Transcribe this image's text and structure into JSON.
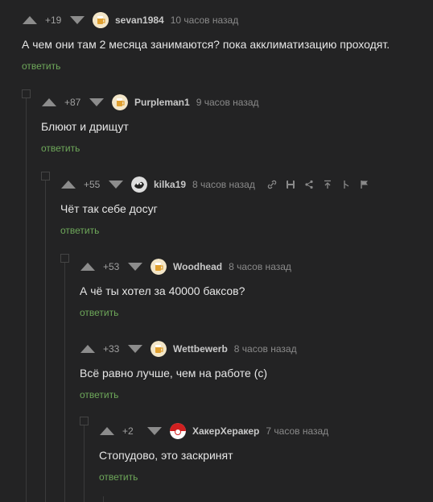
{
  "comments": [
    {
      "rating": "+19",
      "username": "sevan1984",
      "time": "10 часов назад",
      "text": "А чем они там 2 месяца занимаются? пока акклиматизацию проходят.",
      "reply": "ответить",
      "avatar": "beer-avatar"
    },
    {
      "rating": "+87",
      "username": "Purpleman1",
      "time": "9 часов назад",
      "text": "Блюют и дрищут",
      "reply": "ответить",
      "avatar": "beer-avatar"
    },
    {
      "rating": "+55",
      "username": "kilka19",
      "time": "8 часов назад",
      "text": "Чёт так себе досуг",
      "reply": "ответить",
      "avatar": "bw-avatar"
    },
    {
      "rating": "+53",
      "username": "Woodhead",
      "time": "8 часов назад",
      "text": "А чё ты хотел за 40000 баксов?",
      "reply": "ответить",
      "avatar": "beer-avatar"
    },
    {
      "rating": "+33",
      "username": "Wettbewerb",
      "time": "8 часов назад",
      "text": "Всё равно лучше, чем на работе (с)",
      "reply": "ответить",
      "avatar": "beer-avatar"
    },
    {
      "rating": "+2",
      "username": "ХакерХеракер",
      "time": "7 часов назад",
      "text": "Стопудово, это заскринят",
      "reply": "ответить",
      "avatar": "red-avatar"
    }
  ],
  "actions": [
    "link-icon",
    "save-icon",
    "share-icon",
    "go-to-parent-icon",
    "branch-icon",
    "report-flag-icon"
  ],
  "colors": {
    "background": "#232324",
    "reply": "#6ea85a",
    "arrow": "#8c8c8c"
  }
}
